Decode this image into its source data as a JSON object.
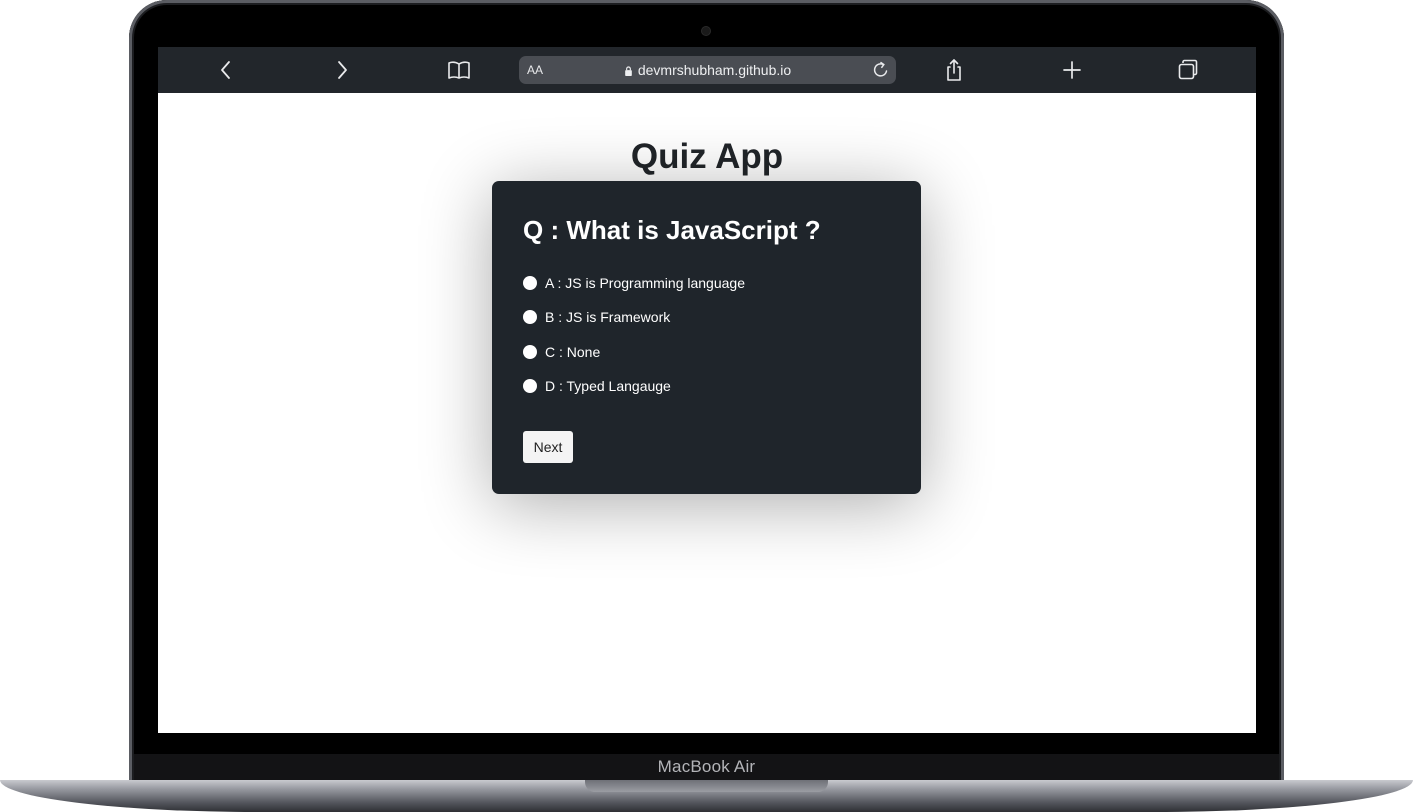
{
  "device": {
    "brand": "MacBook Air"
  },
  "browser": {
    "text_size_label": "AA",
    "url": "devmrshubham.github.io",
    "icons": [
      "back-icon",
      "forward-icon",
      "bookmarks-icon",
      "lock-icon",
      "reload-icon",
      "share-icon",
      "new-tab-icon",
      "tabs-icon"
    ]
  },
  "page": {
    "title": "Quiz App",
    "question": "Q : What is JavaScript ?",
    "options": [
      {
        "label": "A : JS is Programming language"
      },
      {
        "label": "B : JS is Framework"
      },
      {
        "label": "C : None"
      },
      {
        "label": "D : Typed Langauge"
      }
    ],
    "next_label": "Next"
  },
  "colors": {
    "card_background": "#1f252b",
    "toolbar_background": "#22262b",
    "title_text": "#212529"
  }
}
